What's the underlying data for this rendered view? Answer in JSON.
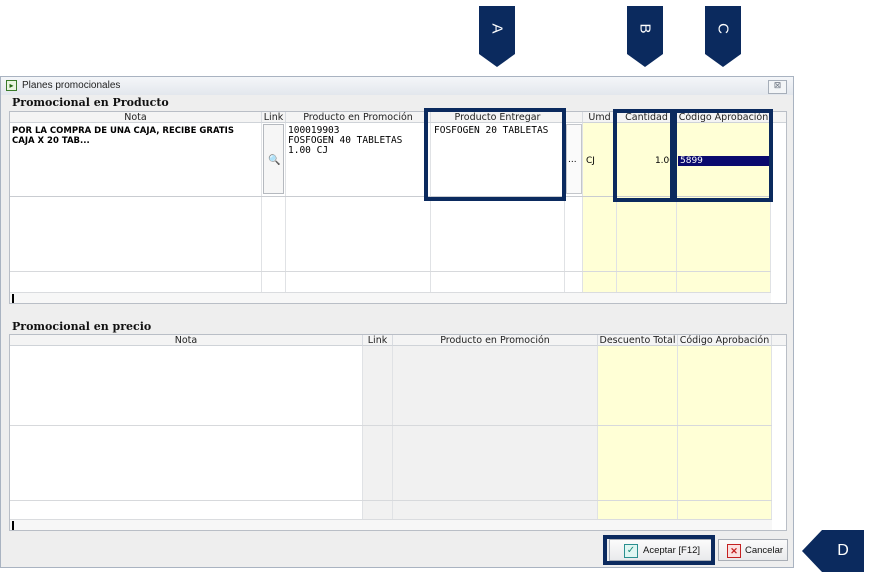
{
  "callouts": {
    "a": "A",
    "b": "B",
    "c": "C",
    "d": "D"
  },
  "window": {
    "title": "Planes promocionales",
    "close_glyph": "⊠"
  },
  "section_product": {
    "title": "Promocional en Producto",
    "headers": {
      "nota": "Nota",
      "link": "Link",
      "producto_promocion": "Producto en Promoción",
      "producto_entregar": "Producto Entregar",
      "umd": "Umd",
      "cantidad": "Cantidad",
      "codigo_aprobacion": "Código Aprobación"
    },
    "row": {
      "nota": "POR LA COMPRA DE UNA CAJA, RECIBE GRATIS CAJA X 20 TAB...",
      "producto_promocion_code": "100019903",
      "producto_promocion_name": "FOSFOGEN 40 TABLETAS",
      "producto_promocion_qty": "1.00 CJ",
      "producto_entregar": "FOSFOGEN 20 TABLETAS",
      "ellipsis": "...",
      "umd": "CJ",
      "cantidad": "1.00",
      "codigo_aprobacion": "5899"
    }
  },
  "section_price": {
    "title": "Promocional en precio",
    "headers": {
      "nota": "Nota",
      "link": "Link",
      "producto_promocion": "Producto en Promoción",
      "descuento_total": "Descuento Total",
      "codigo_aprobacion": "Código Aprobación"
    }
  },
  "buttons": {
    "accept": "Aceptar [F12]",
    "cancel": "Cancelar"
  },
  "colors": {
    "highlight": "#0b2a5e",
    "selection": "#0a0a6e",
    "yellow_column": "#ffffd6"
  }
}
